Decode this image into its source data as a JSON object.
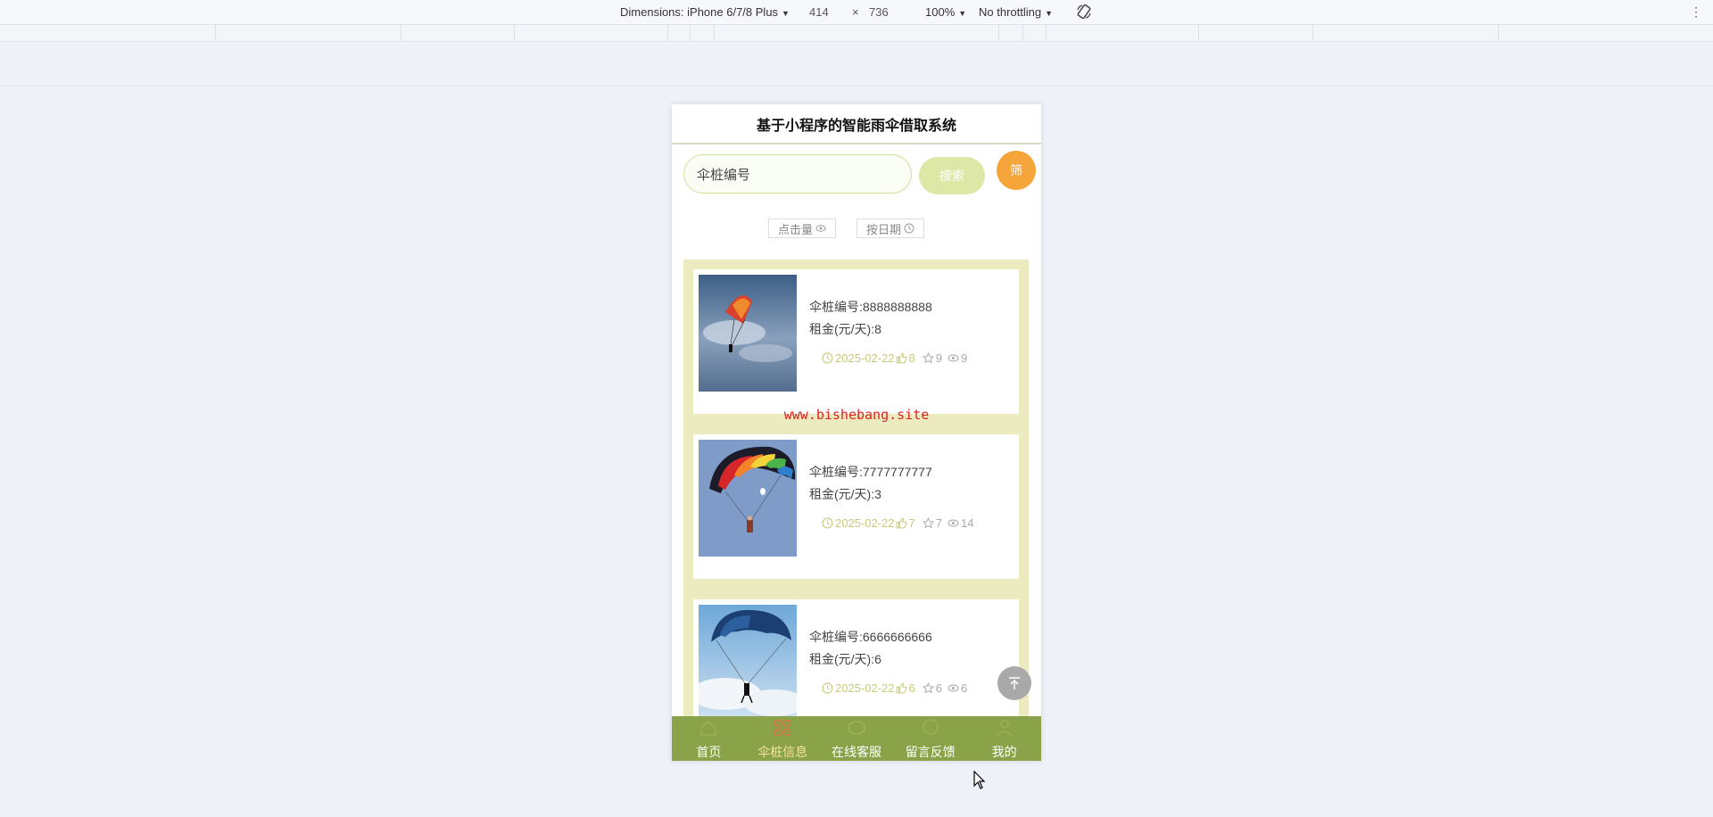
{
  "devtools": {
    "device_label": "Dimensions: iPhone 6/7/8 Plus",
    "width": "414",
    "times": "×",
    "height": "736",
    "zoom": "100%",
    "throttling": "No throttling"
  },
  "app": {
    "title": "基于小程序的智能雨伞借取系统",
    "search": {
      "value": "伞桩编号",
      "button": "搜索",
      "filter_button": "筛"
    },
    "sort": {
      "by_clicks": "点击量",
      "by_date": "按日期"
    },
    "watermark": "www.bishebang.site",
    "items": [
      {
        "code": "伞桩编号:8888888888",
        "rent": "租金(元/天):8",
        "date": "2025-02-22",
        "likes": "8",
        "favorites": "9",
        "views": "9"
      },
      {
        "code": "伞桩编号:7777777777",
        "rent": "租金(元/天):3",
        "date": "2025-02-22",
        "likes": "7",
        "favorites": "7",
        "views": "14"
      },
      {
        "code": "伞桩编号:6666666666",
        "rent": "租金(元/天):6",
        "date": "2025-02-22",
        "likes": "6",
        "favorites": "6",
        "views": "6"
      }
    ],
    "tabs": [
      {
        "label": "首页",
        "icon": "home-icon"
      },
      {
        "label": "伞桩信息",
        "icon": "grid-icon",
        "active": true
      },
      {
        "label": "在线客服",
        "icon": "service-icon"
      },
      {
        "label": "留言反馈",
        "icon": "message-icon"
      },
      {
        "label": "我的",
        "icon": "user-icon"
      }
    ]
  },
  "colors": {
    "accent": "#8aa248",
    "filter": "#f5a53a",
    "list_bg": "#ecebc0",
    "watermark": "#e0201e"
  }
}
